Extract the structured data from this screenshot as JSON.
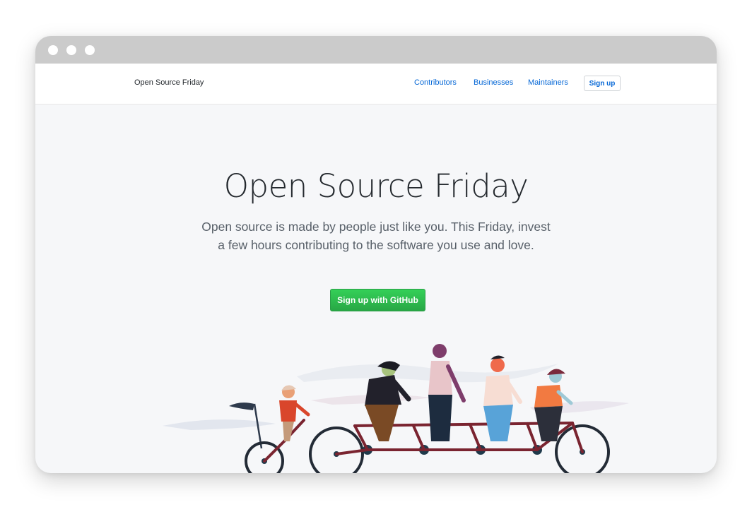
{
  "nav": {
    "brand": "Open Source Friday",
    "links": [
      "Contributors",
      "Businesses",
      "Maintainers"
    ],
    "signup": "Sign up"
  },
  "hero": {
    "title": "Open Source Friday",
    "subtitle": "Open source is made by people just like you. This Friday, invest a few hours contributing to the software you use and love.",
    "cta": "Sign up with GitHub"
  },
  "colors": {
    "link": "#0366d6",
    "cta_green": "#2ea44f",
    "background": "#f6f7f9"
  }
}
